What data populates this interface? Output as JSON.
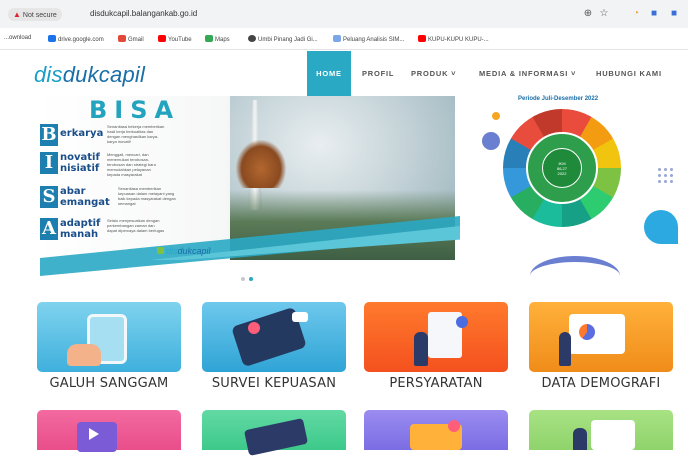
{
  "browser": {
    "security_label": "Not secure",
    "url": "disdukcapil.balangankab.go.id",
    "bookmarks": [
      "...ownload",
      "drive.google.com",
      "Gmail",
      "YouTube",
      "Maps",
      "Umbi Pinang Jadi Gi...",
      "Peluang Analisis SIM...",
      "KUPU-KUPU KUPU-..."
    ],
    "colors": {
      "gmail": "#e3493b",
      "youtube": "#ff0000",
      "maps": "#34a853",
      "drive": "#1a73e8"
    }
  },
  "site": {
    "logo_prefix": "dis",
    "logo_suffix": "dukcapil",
    "nav": [
      {
        "label": "HOME",
        "active": true
      },
      {
        "label": "PROFIL"
      },
      {
        "label": "PRODUK ˅"
      },
      {
        "label": "MEDIA & INFORMASI ˅"
      },
      {
        "label": "HUBUNGI KAMI"
      }
    ],
    "accent": "#2aa9c4"
  },
  "banner": {
    "headline": "BISA",
    "values": [
      {
        "letter": "B",
        "rest": "erkarya",
        "text": "Senantiasa bekerja memberikan hasil kerja berkualitas dan dengan menghasilkan karya-karya inovatif"
      },
      {
        "letter": "I",
        "rest": "novatif\nnisiatif",
        "text": "Menggali, mencari, dan menemukan terobosan-terobosan dan strategi baru memudahkan pelayanan kepada masyarakat"
      },
      {
        "letter": "S",
        "rest": "abar\nemangat",
        "text": "Senantiasa memberikan kepuasan dalam melayani yang baik kepada masyarakat dengan semangat"
      },
      {
        "letter": "A",
        "rest": "adaptif\nmanah",
        "text": "Selalu menyesuaikan dengan perkembangan zaman dan dapat dipercaya dalam bertugas"
      }
    ],
    "footer_logo_prefix": "dis",
    "footer_logo_suffix": "dukcapil",
    "side_period": "Periode Juli-Desember 2022",
    "pie_center": "IKM\n86,27\n2022"
  },
  "carousel": {
    "slides": 2,
    "active": 2
  },
  "services": [
    {
      "label": "GALUH SANGGAM",
      "color_top": "#7fd3ee",
      "color_bottom": "#3fb0dd"
    },
    {
      "label": "SURVEI KEPUASAN",
      "color_top": "#6ec8ec",
      "color_bottom": "#2fa4d6"
    },
    {
      "label": "PERSYARATAN",
      "color_top": "#ff7a2d",
      "color_bottom": "#f4511e"
    },
    {
      "label": "DATA DEMOGRAFI",
      "color_top": "#ffb13a",
      "color_bottom": "#f08c1a"
    }
  ],
  "services_row2_colors": [
    "#e94e8a",
    "#3dc98a",
    "#7b6de3",
    "#8fd36b"
  ]
}
